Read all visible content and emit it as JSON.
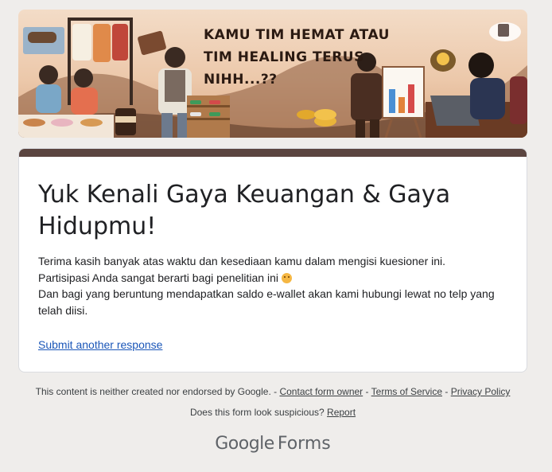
{
  "banner": {
    "text": "KAMU TIM HEMAT ATAU\nTIM HEALING TERUS\nNIHH...??",
    "colors": {
      "top": "#f3dcc7",
      "bottom": "#d9aa86",
      "card_header": "#5b4540"
    }
  },
  "form": {
    "title": "Yuk Kenali Gaya Keuangan & Gaya Hidupmu!",
    "desc_line1": "Terima kasih banyak atas waktu dan kesediaan kamu dalam mengisi kuesioner ini.",
    "desc_line2": "Partisipasi Anda sangat berarti bagi penelitian ini",
    "desc_line2_icon": "smiling-face-emoji",
    "desc_line3": "Dan bagi yang beruntung mendapatkan saldo e-wallet akan kami hubungi lewat no telp yang telah diisi.",
    "submit_another": "Submit another response"
  },
  "footer": {
    "disclaimer": "This content is neither created nor endorsed by Google. -",
    "contact_owner": "Contact form owner",
    "sep1": "-",
    "terms": "Terms of Service",
    "sep2": "-",
    "privacy": "Privacy Policy",
    "suspicious": "Does this form look suspicious?",
    "report": "Report",
    "brand": "Google",
    "product": "Forms"
  }
}
